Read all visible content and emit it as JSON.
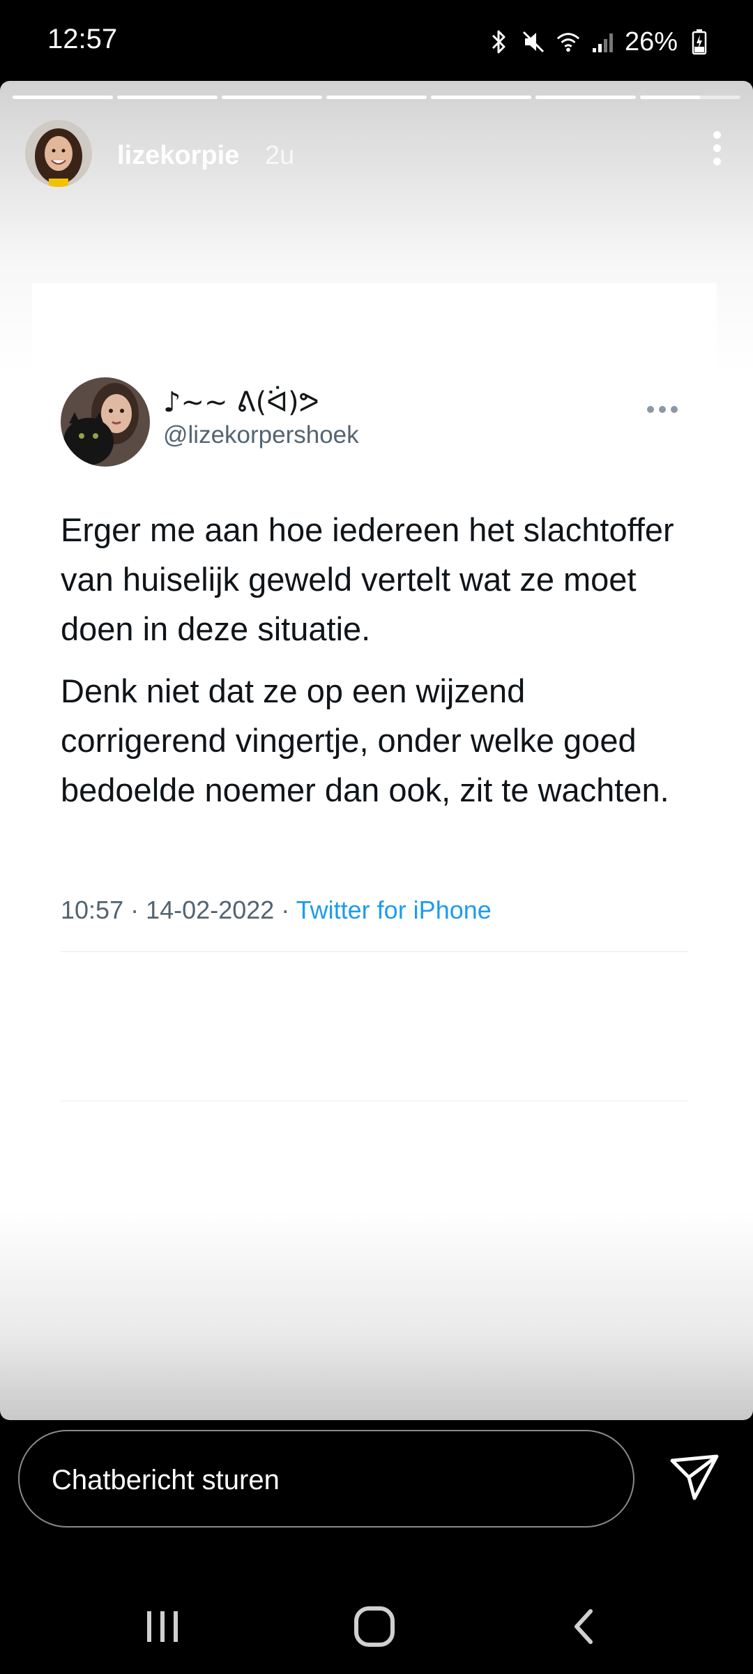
{
  "status_bar": {
    "time": "12:57",
    "battery_percent": "26%",
    "icons": [
      "bluetooth-icon",
      "mute-icon",
      "wifi-icon",
      "signal-icon",
      "battery-charging-icon"
    ]
  },
  "story": {
    "segments_total": 7,
    "current_segment": 7,
    "current_progress": 0.6,
    "username": "lizekorpie",
    "time_ago": "2u",
    "menu_icon": "more-vertical-icon"
  },
  "tweet": {
    "display_name": "♪~~ ᕕ(ᐛ)ᕗ",
    "handle": "@lizekorpershoek",
    "paragraph_1": "Erger me aan hoe iedereen het slachtoffer van huiselijk geweld vertelt wat ze moet doen in deze situatie.",
    "paragraph_2": "Denk niet dat ze op een wijzend corrigerend vingertje, onder welke goed bedoelde noemer dan ook, zit te wachten.",
    "time": "10:57",
    "date": "14-02-2022",
    "separator": "·",
    "source": "Twitter for iPhone",
    "colors": {
      "text": "#0f1419",
      "secondary": "#536471",
      "link": "#1d9bf0"
    }
  },
  "reply": {
    "placeholder": "Chatbericht sturen",
    "send_icon": "send-icon"
  },
  "nav": {
    "recents_icon": "recents-icon",
    "home_icon": "home-icon",
    "back_icon": "back-icon"
  }
}
